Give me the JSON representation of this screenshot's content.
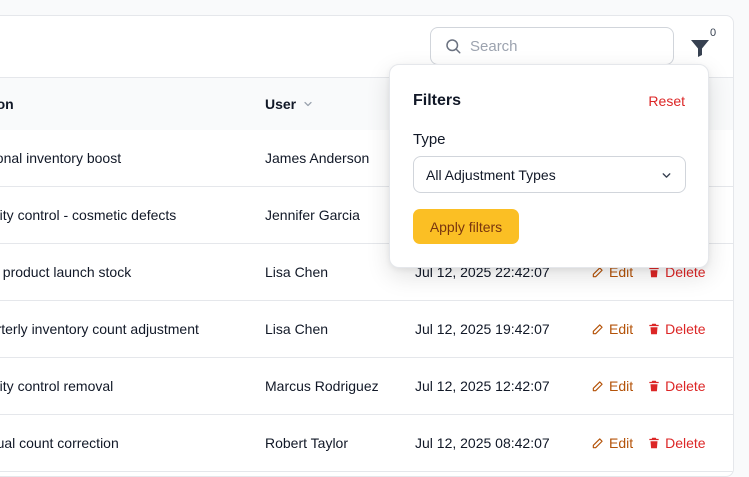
{
  "search": {
    "placeholder": "Search"
  },
  "filter": {
    "count": "0"
  },
  "table": {
    "columns": {
      "reason": "ason",
      "user": "User"
    },
    "rows": [
      {
        "reason": "asonal inventory boost",
        "user": "James Anderson",
        "date": "",
        "edit": "",
        "delete": ""
      },
      {
        "reason": "uality control - cosmetic defects",
        "user": "Jennifer Garcia",
        "date": "",
        "edit": "",
        "delete": ""
      },
      {
        "reason": "ew product launch stock",
        "user": "Lisa Chen",
        "date": "Jul 12, 2025 22:42:07",
        "edit": "Edit",
        "delete": "Delete"
      },
      {
        "reason": "uarterly inventory count adjustment",
        "user": "Lisa Chen",
        "date": "Jul 12, 2025 19:42:07",
        "edit": "Edit",
        "delete": "Delete"
      },
      {
        "reason": "uality control removal",
        "user": "Marcus Rodriguez",
        "date": "Jul 12, 2025 12:42:07",
        "edit": "Edit",
        "delete": "Delete"
      },
      {
        "reason": "nnual count correction",
        "user": "Robert Taylor",
        "date": "Jul 12, 2025 08:42:07",
        "edit": "Edit",
        "delete": "Delete"
      }
    ]
  },
  "filters_popover": {
    "title": "Filters",
    "reset": "Reset",
    "type_label": "Type",
    "type_value": "All Adjustment Types",
    "apply": "Apply filters"
  },
  "colors": {
    "accent": "#fbbf24",
    "edit": "#b45309",
    "delete": "#dc2626"
  }
}
